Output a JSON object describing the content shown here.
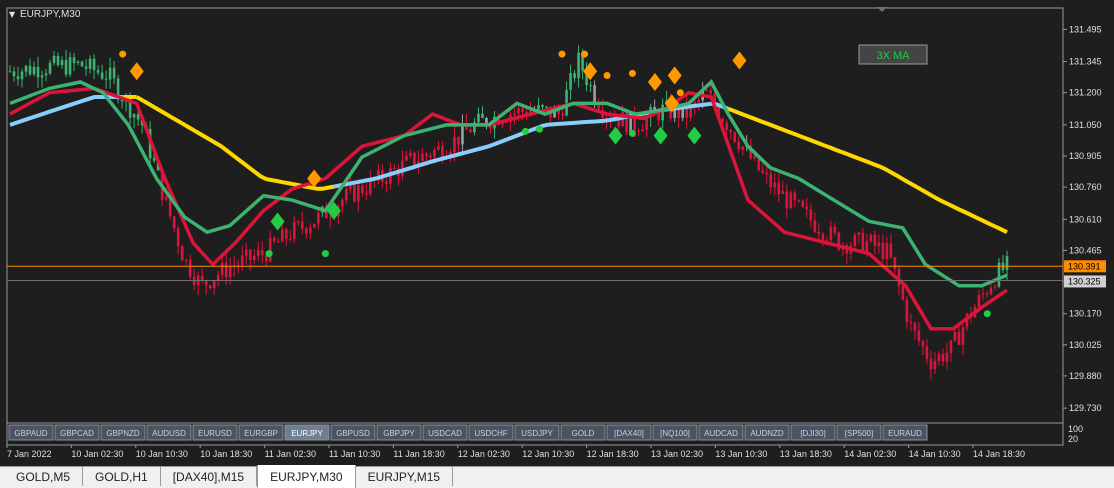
{
  "window": {
    "title": "EURJPY,M30"
  },
  "indicator_label": "3X MA",
  "colors": {
    "background": "#1e1e1e",
    "grid_border": "#9a9a9a",
    "text": "#e0e0e0",
    "candle_up": "#3cb371",
    "candle_down": "#dc143c",
    "candle_neutral": "#9aa0a6",
    "ma_fast": "#dc143c",
    "ma_mid": "#3cb371",
    "ma_slow_up": "#87cefa",
    "ma_slow_down": "#ffd700",
    "signal_sell": "#ff9900",
    "signal_buy": "#22cc44",
    "bid_line": "#ff8c00",
    "ask_line": "#808080",
    "label_green": "#22cc44"
  },
  "price_tag_bid": "130.391",
  "price_tag_ask": "130.325",
  "symbol_buttons": [
    "GBPAUD",
    "GBPCAD",
    "GBPNZD",
    "AUDUSD",
    "EURUSD",
    "EURGBP",
    "EURJPY",
    "GBPUSD",
    "GBPJPY",
    "USDCAD",
    "USDCHF",
    "USDJPY",
    "GOLD",
    "[DAX40]",
    "[NQ100]",
    "AUDCAD",
    "AUDNZD",
    "[DJI30]",
    "[SP500]",
    "EURAUD"
  ],
  "active_symbol": "EURJPY",
  "indicator_window_scale": [
    "100",
    "20"
  ],
  "tabs": [
    {
      "label": "GOLD,M5",
      "active": false
    },
    {
      "label": "GOLD,H1",
      "active": false
    },
    {
      "label": "[DAX40],M15",
      "active": false
    },
    {
      "label": "EURJPY,M30",
      "active": true
    },
    {
      "label": "EURJPY,M15",
      "active": false
    }
  ],
  "chart_data": {
    "type": "line",
    "symbol": "EURJPY",
    "timeframe": "M30",
    "ylim": [
      129.67,
      131.59
    ],
    "y_ticks": [
      "131.495",
      "131.345",
      "131.200",
      "131.050",
      "130.905",
      "130.760",
      "130.610",
      "130.465",
      "130.320",
      "130.170",
      "130.025",
      "129.880",
      "129.730"
    ],
    "y_tick_values": [
      131.495,
      131.345,
      131.2,
      131.05,
      130.905,
      130.76,
      130.61,
      130.465,
      130.32,
      130.17,
      130.025,
      129.88,
      129.73
    ],
    "x_tick_labels": [
      "7 Jan 2022",
      "10 Jan 02:30",
      "10 Jan 10:30",
      "10 Jan 18:30",
      "11 Jan 02:30",
      "11 Jan 10:30",
      "11 Jan 18:30",
      "12 Jan 02:30",
      "12 Jan 10:30",
      "12 Jan 18:30",
      "13 Jan 02:30",
      "13 Jan 10:30",
      "13 Jan 18:30",
      "14 Jan 02:30",
      "14 Jan 10:30",
      "14 Jan 18:30"
    ],
    "bars": 250,
    "close_path": [
      [
        0,
        131.3
      ],
      [
        12,
        131.32
      ],
      [
        25,
        131.33
      ],
      [
        35,
        131.28
      ],
      [
        47,
        131.05
      ],
      [
        55,
        130.7
      ],
      [
        62,
        130.42
      ],
      [
        68,
        130.3
      ],
      [
        73,
        130.35
      ],
      [
        80,
        130.4
      ],
      [
        90,
        130.45
      ],
      [
        100,
        130.55
      ],
      [
        110,
        130.62
      ],
      [
        120,
        130.72
      ],
      [
        132,
        130.8
      ],
      [
        142,
        130.88
      ],
      [
        155,
        130.95
      ],
      [
        165,
        131.05
      ],
      [
        175,
        131.1
      ],
      [
        185,
        131.12
      ],
      [
        195,
        131.1
      ],
      [
        202,
        131.35
      ],
      [
        207,
        131.2
      ],
      [
        212,
        131.1
      ],
      [
        222,
        131.05
      ],
      [
        232,
        131.12
      ],
      [
        241,
        131.1
      ],
      [
        247,
        131.2
      ],
      [
        255,
        131.05
      ],
      [
        260,
        130.95
      ],
      [
        268,
        130.8
      ],
      [
        276,
        130.7
      ],
      [
        285,
        130.6
      ],
      [
        295,
        130.5
      ],
      [
        305,
        130.5
      ],
      [
        312,
        130.45
      ],
      [
        320,
        130.1
      ],
      [
        327,
        129.95
      ],
      [
        334,
        130.0
      ],
      [
        340,
        130.15
      ],
      [
        345,
        130.25
      ],
      [
        350,
        130.35
      ],
      [
        354,
        130.39
      ]
    ],
    "series": [
      {
        "values": [
          [
            0,
            131.15
          ],
          [
            14,
            131.22
          ],
          [
            25,
            131.25
          ],
          [
            33,
            131.2
          ],
          [
            42,
            131.05
          ],
          [
            52,
            130.8
          ],
          [
            62,
            130.62
          ],
          [
            70,
            130.55
          ],
          [
            78,
            130.58
          ],
          [
            90,
            130.72
          ],
          [
            100,
            130.7
          ],
          [
            112,
            130.65
          ],
          [
            125,
            130.9
          ],
          [
            140,
            131.0
          ],
          [
            155,
            131.05
          ],
          [
            170,
            131.05
          ],
          [
            180,
            131.15
          ],
          [
            190,
            131.1
          ],
          [
            200,
            131.15
          ],
          [
            212,
            131.15
          ],
          [
            222,
            131.1
          ],
          [
            232,
            131.12
          ],
          [
            241,
            131.15
          ],
          [
            249,
            131.25
          ],
          [
            255,
            131.1
          ],
          [
            262,
            130.95
          ],
          [
            270,
            130.85
          ],
          [
            280,
            130.8
          ],
          [
            290,
            130.72
          ],
          [
            305,
            130.6
          ],
          [
            317,
            130.57
          ],
          [
            325,
            130.4
          ],
          [
            337,
            130.3
          ],
          [
            345,
            130.3
          ],
          [
            354,
            130.35
          ]
        ]
      },
      {
        "values": [
          [
            0,
            131.1
          ],
          [
            14,
            131.2
          ],
          [
            30,
            131.22
          ],
          [
            45,
            131.15
          ],
          [
            55,
            130.8
          ],
          [
            65,
            130.5
          ],
          [
            72,
            130.4
          ],
          [
            80,
            130.5
          ],
          [
            90,
            130.65
          ],
          [
            100,
            130.75
          ],
          [
            112,
            130.8
          ],
          [
            125,
            130.95
          ],
          [
            140,
            131.0
          ],
          [
            150,
            131.1
          ],
          [
            160,
            131.05
          ],
          [
            170,
            131.05
          ],
          [
            185,
            131.1
          ],
          [
            200,
            131.15
          ],
          [
            212,
            131.1
          ],
          [
            225,
            131.08
          ],
          [
            232,
            131.12
          ],
          [
            241,
            131.2
          ],
          [
            249,
            131.18
          ],
          [
            262,
            130.7
          ],
          [
            275,
            130.55
          ],
          [
            290,
            130.5
          ],
          [
            305,
            130.45
          ],
          [
            318,
            130.3
          ],
          [
            327,
            130.1
          ],
          [
            335,
            130.1
          ],
          [
            345,
            130.2
          ],
          [
            354,
            130.28
          ]
        ]
      },
      {
        "values": [
          [
            0,
            131.05
          ],
          [
            16,
            131.12
          ],
          [
            30,
            131.18
          ],
          [
            45,
            131.18
          ],
          [
            62,
            131.05
          ],
          [
            75,
            130.95
          ],
          [
            90,
            130.8
          ],
          [
            110,
            130.75
          ],
          [
            130,
            130.8
          ],
          [
            150,
            130.88
          ],
          [
            170,
            130.95
          ],
          [
            190,
            131.05
          ],
          [
            212,
            131.07
          ],
          [
            232,
            131.12
          ],
          [
            250,
            131.15
          ],
          [
            270,
            131.05
          ],
          [
            290,
            130.95
          ],
          [
            310,
            130.85
          ],
          [
            330,
            130.7
          ],
          [
            354,
            130.55
          ]
        ]
      }
    ],
    "slow_color_switch": [
      40,
      45,
      115,
      118,
      255
    ],
    "sell_signals": [
      [
        45,
        131.3
      ],
      [
        108,
        130.8
      ],
      [
        206,
        131.3
      ],
      [
        229,
        131.25
      ],
      [
        235,
        131.15
      ],
      [
        236,
        131.28
      ],
      [
        259,
        131.35
      ]
    ],
    "buy_signals": [
      [
        95,
        130.6
      ],
      [
        115,
        130.65
      ],
      [
        215,
        131.0
      ],
      [
        231,
        131.0
      ],
      [
        243,
        131.0
      ]
    ],
    "dots_orange": [
      [
        40,
        131.38
      ],
      [
        196,
        131.38
      ],
      [
        204,
        131.38
      ],
      [
        212,
        131.28
      ],
      [
        221,
        131.29
      ],
      [
        229,
        131.25
      ],
      [
        238,
        131.2
      ]
    ],
    "dots_green": [
      [
        92,
        130.45
      ],
      [
        112,
        130.45
      ],
      [
        183,
        131.02
      ],
      [
        188,
        131.03
      ],
      [
        221,
        131.01
      ],
      [
        347,
        130.17
      ]
    ]
  }
}
